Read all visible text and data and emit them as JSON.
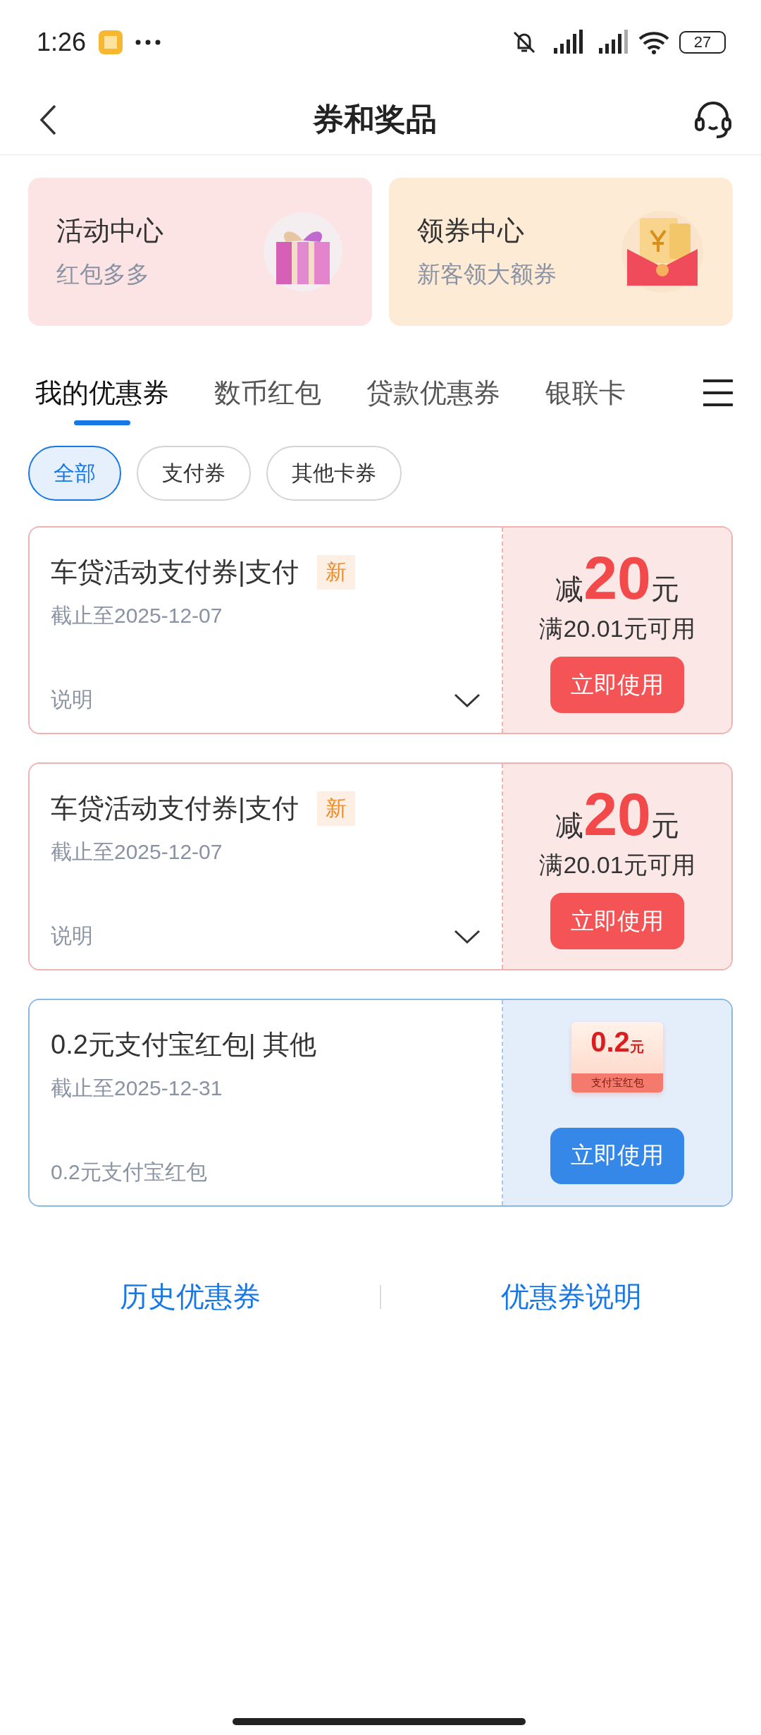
{
  "status_bar": {
    "time": "1:26",
    "battery": "27"
  },
  "header": {
    "title": "券和奖品"
  },
  "promo_cards": [
    {
      "title": "活动中心",
      "subtitle": "红包多多",
      "kind": "gift"
    },
    {
      "title": "领券中心",
      "subtitle": "新客领大额券",
      "kind": "envelope"
    }
  ],
  "tabs": [
    {
      "label": "我的优惠券",
      "selected": true
    },
    {
      "label": "数币红包",
      "selected": false
    },
    {
      "label": "贷款优惠券",
      "selected": false
    },
    {
      "label": "银联卡",
      "selected": false
    }
  ],
  "filters": [
    {
      "label": "全部",
      "selected": true
    },
    {
      "label": "支付券",
      "selected": false
    },
    {
      "label": "其他卡券",
      "selected": false
    }
  ],
  "coupons": [
    {
      "kind": "discount",
      "title": "车贷活动支付券|支付",
      "tag": "新",
      "expiry": "截止至2025-12-07",
      "note": "说明",
      "prefix": "减",
      "amount": "20",
      "unit": "元",
      "condition": "满20.01元可用",
      "button": "立即使用"
    },
    {
      "kind": "discount",
      "title": "车贷活动支付券|支付",
      "tag": "新",
      "expiry": "截止至2025-12-07",
      "note": "说明",
      "prefix": "减",
      "amount": "20",
      "unit": "元",
      "condition": "满20.01元可用",
      "button": "立即使用"
    },
    {
      "kind": "redpacket",
      "title": "0.2元支付宝红包| 其他",
      "expiry": "截止至2025-12-31",
      "note": "0.2元支付宝红包",
      "amount": "0.2",
      "unit": "元",
      "badge_label": "支付宝红包",
      "button": "立即使用"
    }
  ],
  "footer_links": [
    "历史优惠券",
    "优惠券说明"
  ]
}
